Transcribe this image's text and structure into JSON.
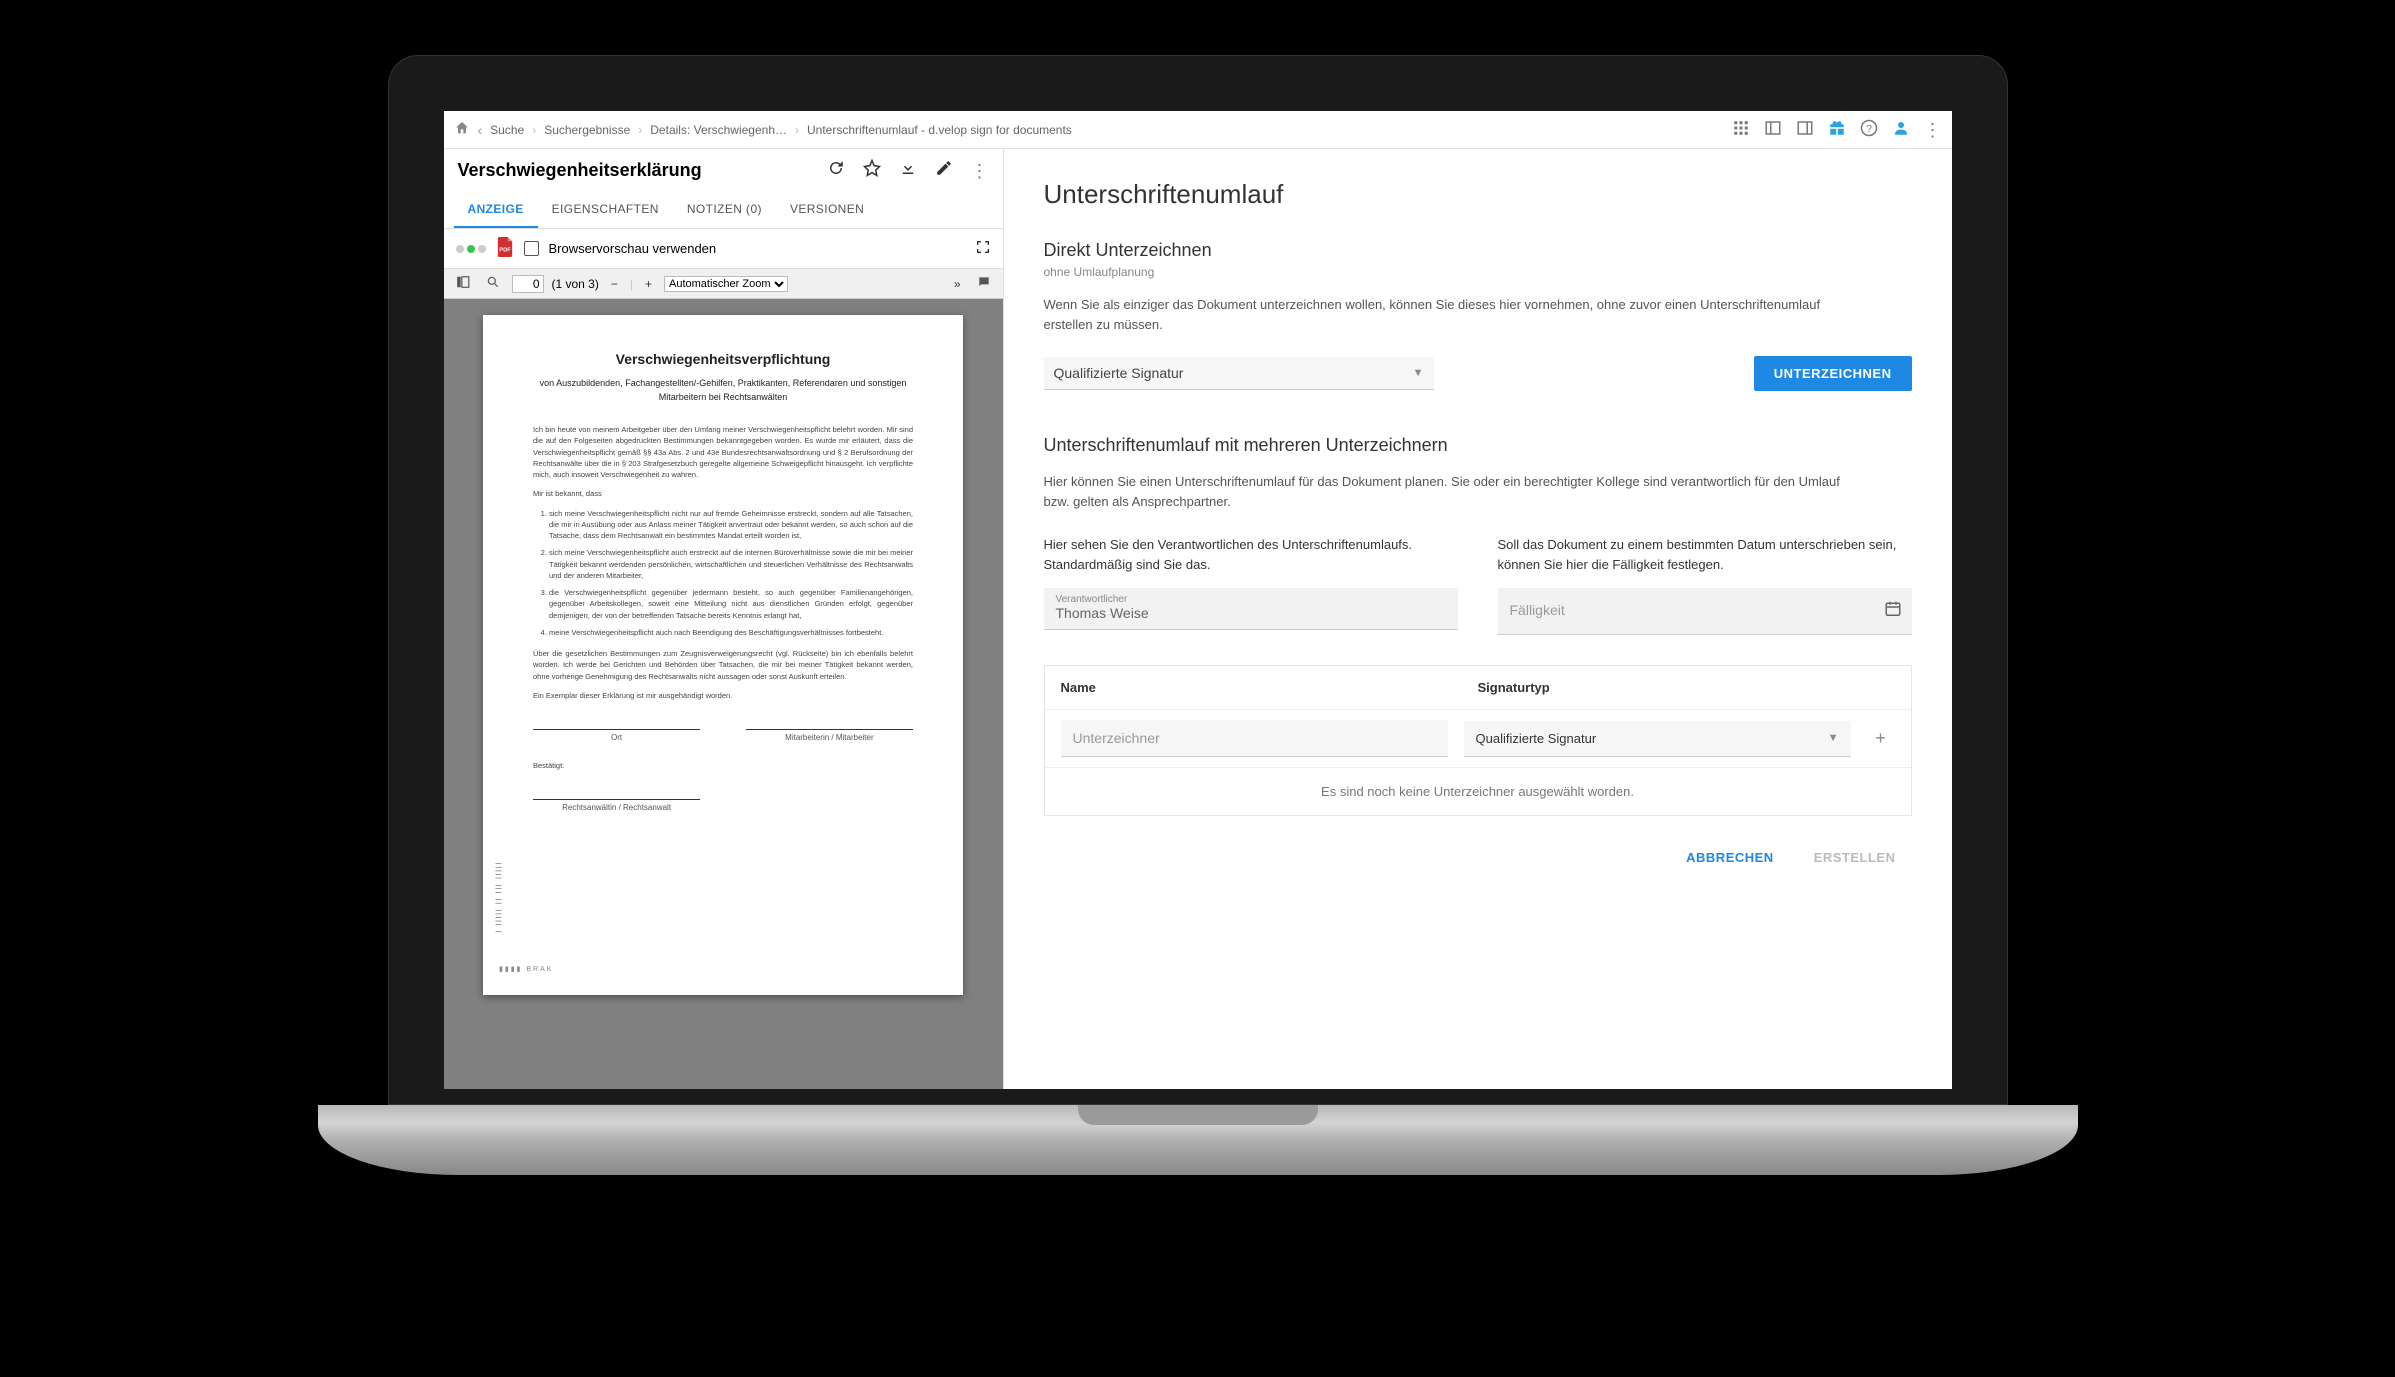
{
  "breadcrumb": {
    "items": [
      "Suche",
      "Suchergebnisse",
      "Details: Verschwiegenh…",
      "Unterschriftenumlauf - d.velop sign for documents"
    ]
  },
  "doc": {
    "title": "Verschwiegenheitserklärung"
  },
  "tabs": {
    "t0": "ANZEIGE",
    "t1": "EIGENSCHAFTEN",
    "t2": "NOTIZEN (0)",
    "t3": "VERSIONEN"
  },
  "subbar": {
    "browser_preview": "Browservorschau verwenden"
  },
  "pdfbar": {
    "page": "0",
    "page_of": "(1 von 3)",
    "zoom": "Automatischer Zoom"
  },
  "pdfdoc": {
    "title": "Verschwiegenheitsverpflichtung",
    "subtitle": "von Auszubildenden, Fachangestellten/-Gehilfen, Praktikanten, Referendaren\nund sonstigen Mitarbeitern bei Rechtsanwälten",
    "p1": "Ich bin heute von meinem Arbeitgeber über den Umfang meiner Verschwiegenheitspflicht belehrt worden. Mir sind die auf den Folgeseiten abgedruckten Bestimmungen bekanntgegeben worden. Es wurde mir erläutert, dass die Verschwiegenheitspflicht gemäß §§ 43a Abs. 2 und 43e Bundesrechtsanwaltsordnung und § 2 Berufsordnung der Rechtsanwälte über die in § 203 Strafgesetzbuch geregelte allgemeine Schweigepflicht hinausgeht. Ich verpflichte mich, auch insoweit Verschwiegenheit zu wahren.",
    "p2": "Mir ist bekannt, dass",
    "li1": "sich meine Verschwiegenheitspflicht nicht nur auf fremde Geheimnisse erstreckt, sondern auf alle Tatsachen, die mir in Ausübung oder aus Anlass meiner Tätigkeit anvertraut oder bekannt werden, so auch schon auf die Tatsache, dass dem Rechtsanwalt ein bestimmtes Mandat erteilt worden ist,",
    "li2": "sich meine Verschwiegenheitspflicht auch erstreckt auf die internen Büroverhältnisse sowie die mir bei meiner Tätigkeit bekannt werdenden persönlichen, wirtschaftlichen und steuerlichen Verhältnisse des Rechtsanwalts und der anderen Mitarbeiter,",
    "li3": "die Verschwiegenheitspflicht gegenüber jedermann besteht, so auch gegenüber Familienangehörigen, gegenüber Arbeitskollegen, soweit eine Mitteilung nicht aus dienstlichen Gründen erfolgt, gegenüber demjenigen, der von der betreffenden Tatsache bereits Kenntnis erlangt hat,",
    "li4": "meine Verschwiegenheitspflicht auch nach Beendigung des Beschäftigungsverhältnisses fortbesteht.",
    "p3": "Über die gesetzlichen Bestimmungen zum Zeugnisverweigerungsrecht (vgl. Rückseite) bin ich ebenfalls belehrt worden. Ich werde bei Gerichten und Behörden über Tatsachen, die mir bei meiner Tätigkeit bekannt werden, ohne vorherige Genehmigung des Rechtsanwalts nicht aussagen oder sonst Auskunft erteilen.",
    "p4": "Ein Exemplar dieser Erklärung ist mir ausgehändigt worden.",
    "sig_left": "Ort",
    "sig_right": "Mitarbeiterin / Mitarbeiter",
    "confirm": "Bestätigt:",
    "sig_bottom": "Rechtsanwältin / Rechtsanwalt"
  },
  "main": {
    "title": "Unterschriftenumlauf",
    "direct_h": "Direkt Unterzeichnen",
    "direct_sub": "ohne Umlaufplanung",
    "direct_desc": "Wenn Sie als einziger das Dokument unterzeichnen wollen, können Sie dieses hier vornehmen, ohne zuvor einen Unterschriftenumlauf erstellen zu müssen.",
    "sig_type": "Qualifizierte Signatur",
    "sign_btn": "UNTERZEICHNEN",
    "multi_h": "Unterschriftenumlauf mit mehreren Unterzeichnern",
    "multi_desc": "Hier können Sie einen Unterschriftenumlauf für das Dokument planen. Sie oder ein berechtigter Kollege sind verantwortlich für den Umlauf bzw. gelten als Ansprechpartner.",
    "resp_help": "Hier sehen Sie den Verantwortlichen des Unterschriftenumlaufs. Standardmäßig sind Sie das.",
    "resp_label": "Verantwortlicher",
    "resp_value": "Thomas Weise",
    "due_help": "Soll das Dokument zu einem bestimmten Datum unterschrieben sein, können Sie hier die Fälligkeit festlegen.",
    "due_placeholder": "Fälligkeit",
    "col_name": "Name",
    "col_sigtype": "Signaturtyp",
    "signer_placeholder": "Unterzeichner",
    "signer_sigtype": "Qualifizierte Signatur",
    "empty_msg": "Es sind noch keine Unterzeichner ausgewählt worden.",
    "cancel": "ABBRECHEN",
    "create": "ERSTELLEN"
  }
}
